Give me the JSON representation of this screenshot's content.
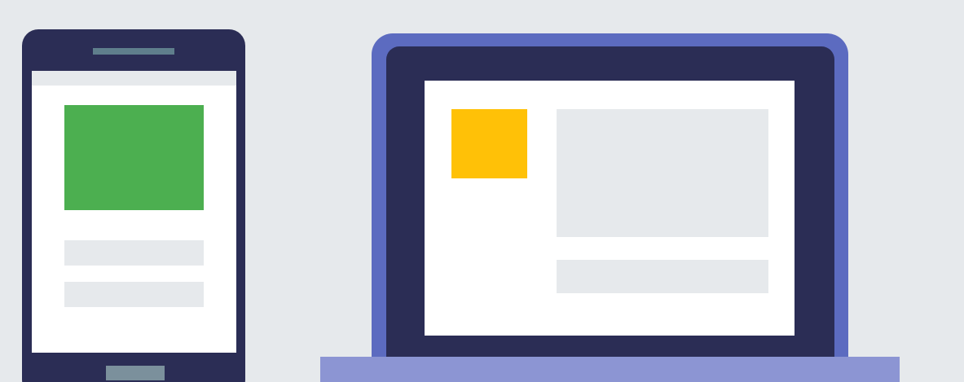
{
  "colors": {
    "background": "#E6E9EC",
    "phone_body": "#2B2D55",
    "phone_speaker": "#5F7E8C",
    "screen": "#FFFFFF",
    "placeholder": "#E6E9EC",
    "phone_image": "#4CAF50",
    "phone_home_button": "#7B909C",
    "laptop_frame": "#5C6BC0",
    "laptop_bezel": "#2B2D55",
    "laptop_thumbnail": "#FFC107",
    "laptop_base": "#8C95D3"
  },
  "phone": {
    "content_blocks": [
      "image-placeholder",
      "text-line",
      "text-line"
    ]
  },
  "laptop": {
    "content_blocks": [
      "thumbnail",
      "content-panel",
      "text-line"
    ]
  }
}
